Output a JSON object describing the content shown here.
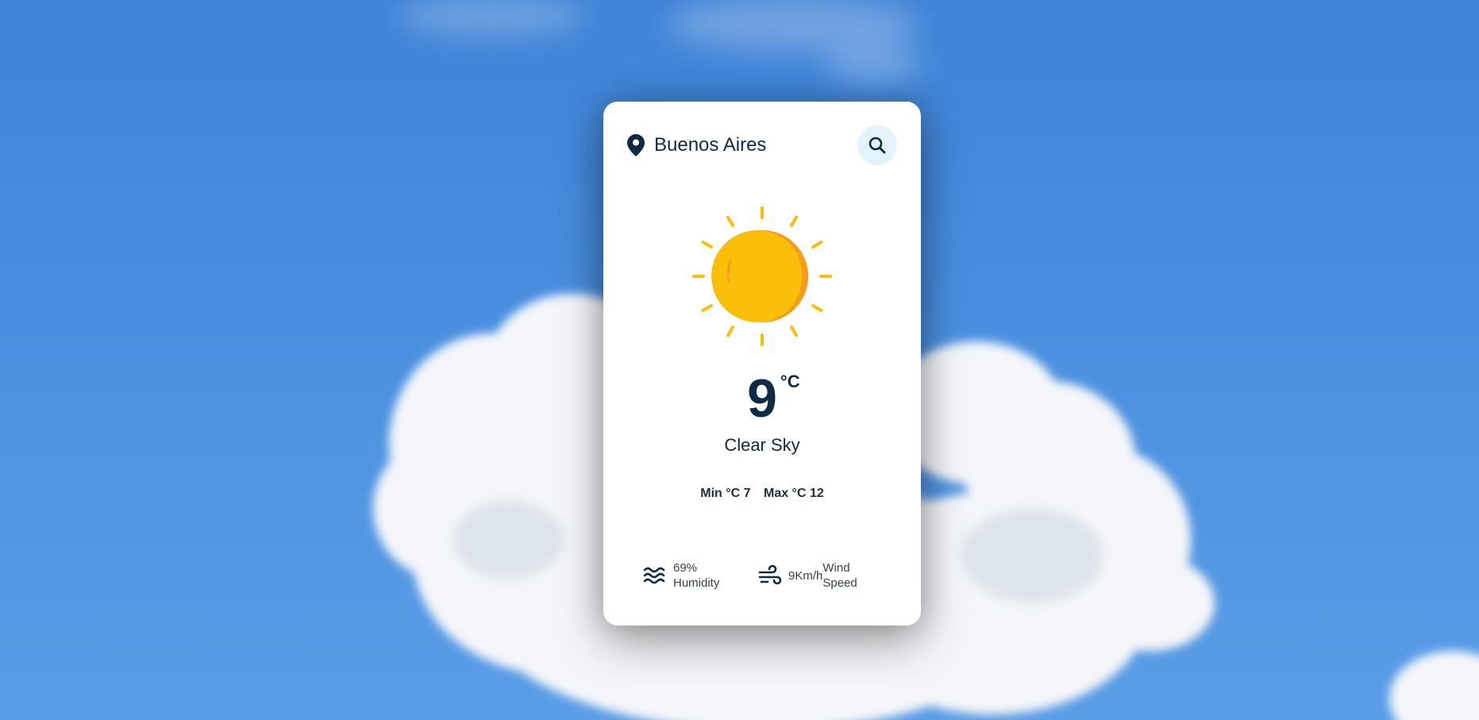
{
  "location": {
    "city": "Buenos Aires",
    "icon": "map-pin-icon"
  },
  "search": {
    "icon": "search-icon"
  },
  "weather": {
    "icon": "sun-icon",
    "temperature": "9",
    "unit": "°C",
    "description": "Clear Sky",
    "min_text": "Min °C 7",
    "max_text": "Max °C 12"
  },
  "humidity": {
    "value": "69%",
    "label": "Humidity",
    "icon": "humidity-waves-icon"
  },
  "wind": {
    "value": "9Km/h",
    "label_line1": "Wind",
    "label_line2": "Speed",
    "icon": "wind-icon"
  },
  "colors": {
    "text_primary": "#0f2a45",
    "sun_yellow": "#fbbf0a",
    "sun_orange": "#f59c1c",
    "search_bg": "#e3f3fb",
    "sky_blue": "#4a8fdf"
  }
}
